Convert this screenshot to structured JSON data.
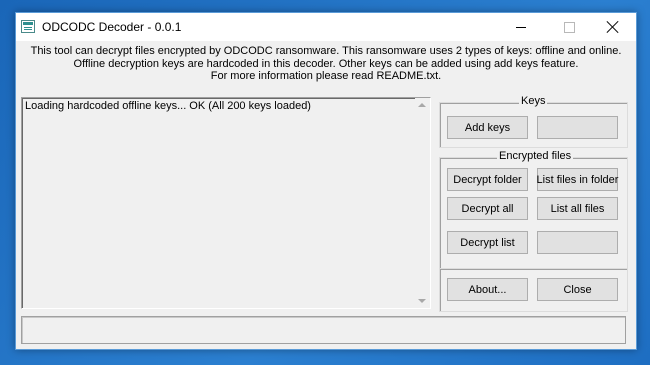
{
  "window": {
    "title": "ODCODC Decoder - 0.0.1",
    "controls": {
      "minimize": "minimize",
      "maximize": "maximize",
      "close": "close"
    }
  },
  "info": {
    "lines": [
      "This tool can decrypt files encrypted by ODCODC ransomware. This ransomware uses 2 types of keys: offline and online.",
      "Offline decryption keys are hardcoded in this decoder. Other keys can be added using add keys feature.",
      "For more information please read README.txt."
    ]
  },
  "log": {
    "lines": [
      "Loading hardcoded offline keys... OK (All 200 keys loaded)"
    ]
  },
  "keys_group": {
    "label": "Keys",
    "add_keys": "Add keys",
    "blank": ""
  },
  "encrypted_group": {
    "label": "Encrypted files",
    "decrypt_folder": "Decrypt folder",
    "list_files_in_folder": "List files in folder",
    "decrypt_all": "Decrypt all",
    "list_all_files": "List all files",
    "decrypt_list": "Decrypt list",
    "blank": ""
  },
  "misc_group": {
    "about": "About...",
    "close": "Close"
  },
  "status": {
    "text": ""
  },
  "colors": {
    "desktop": "#1f6fc0",
    "window_bg": "#f0f0f0",
    "titlebar": "#ffffff",
    "button_bg": "#e1e1e1",
    "button_border": "#adadad"
  }
}
